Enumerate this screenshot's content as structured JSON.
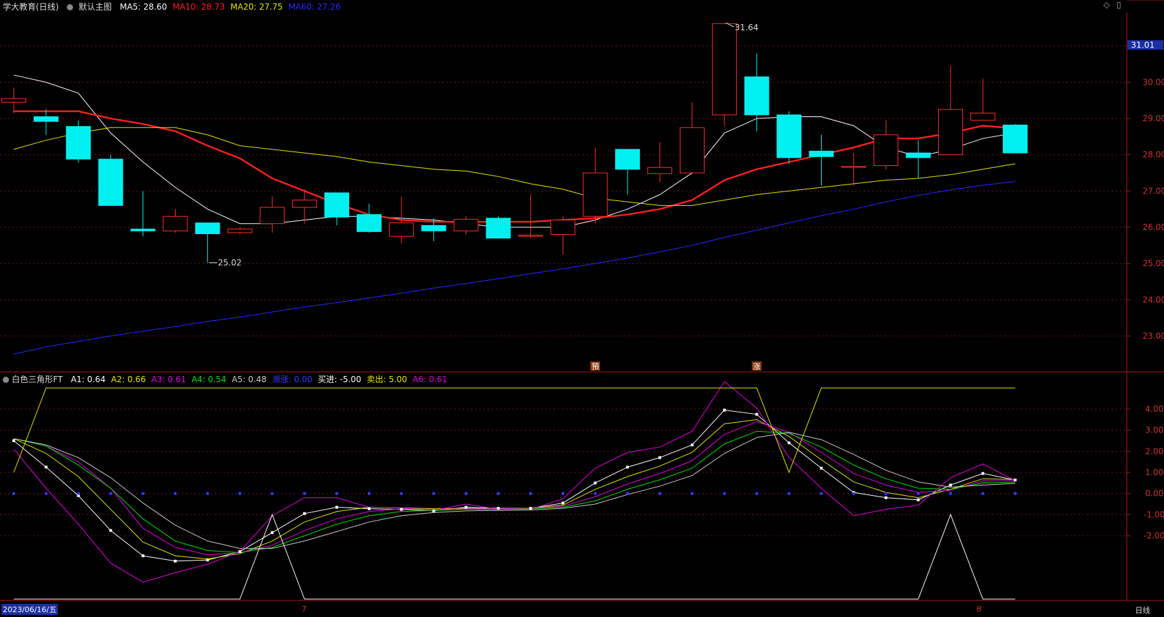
{
  "stock": {
    "title": "学大教育(日线)",
    "template": "默认主图",
    "ma": [
      {
        "label": "MA5: 28.60",
        "color": "#ffffff"
      },
      {
        "label": "MA10: 28.73",
        "color": "#ff2020"
      },
      {
        "label": "MA20: 27.75",
        "color": "#e6e600"
      },
      {
        "label": "MA60: 27.26",
        "color": "#2a2aff"
      }
    ],
    "current_price": "31.01",
    "high_label": "31.64",
    "low_label": "25.02",
    "signals": [
      "預",
      "涨"
    ],
    "window_icons": [
      "◇",
      "▯"
    ]
  },
  "indicator": {
    "name": "白色三角形FT",
    "items": [
      {
        "label": "A1: 0.64",
        "color": "#ffffff"
      },
      {
        "label": "A2: 0.66",
        "color": "#e6e600"
      },
      {
        "label": "A3: 0.61",
        "color": "#e000e0"
      },
      {
        "label": "A4: 0.54",
        "color": "#00e000"
      },
      {
        "label": "A5: 0.48",
        "color": "#cccccc"
      },
      {
        "label": "濒涨: 0.00",
        "color": "#3a3aff"
      },
      {
        "label": "买进: -5.00",
        "color": "#ffffff"
      },
      {
        "label": "卖出: 5.00",
        "color": "#e6e600"
      },
      {
        "label": "A6: 0.61",
        "color": "#e000e0"
      }
    ]
  },
  "bottom": {
    "date_label": "2023/06/16/五",
    "month_7": "7",
    "month_8": "8",
    "period": "日线"
  },
  "chart_data": [
    {
      "type": "candlestick",
      "ylim": [
        22.2,
        31.7
      ],
      "yticks": [
        "31.00",
        "30.00",
        "29.00",
        "28.00",
        "27.00",
        "26.00",
        "25.00",
        "24.00",
        "23.00"
      ],
      "ytick_values": [
        31,
        30,
        29,
        28,
        27,
        26,
        25,
        24,
        23
      ],
      "candles": [
        {
          "o": 29.45,
          "c": 29.55,
          "h": 29.85,
          "l": 29.15
        },
        {
          "o": 29.05,
          "c": 28.92,
          "h": 29.25,
          "l": 28.55
        },
        {
          "o": 28.78,
          "c": 27.88,
          "h": 28.95,
          "l": 27.78
        },
        {
          "o": 27.88,
          "c": 26.6,
          "h": 28.0,
          "l": 26.6
        },
        {
          "o": 25.95,
          "c": 25.9,
          "h": 27.0,
          "l": 25.75
        },
        {
          "o": 25.9,
          "c": 26.3,
          "h": 26.5,
          "l": 25.85
        },
        {
          "o": 26.12,
          "c": 25.82,
          "h": 26.12,
          "l": 25.02
        },
        {
          "o": 25.85,
          "c": 25.95,
          "h": 26.0,
          "l": 25.8
        },
        {
          "o": 26.1,
          "c": 26.55,
          "h": 26.85,
          "l": 25.85
        },
        {
          "o": 26.55,
          "c": 26.75,
          "h": 27.05,
          "l": 26.1
        },
        {
          "o": 26.95,
          "c": 26.28,
          "h": 26.95,
          "l": 26.05
        },
        {
          "o": 26.35,
          "c": 25.88,
          "h": 26.65,
          "l": 25.85
        },
        {
          "o": 25.75,
          "c": 26.12,
          "h": 26.85,
          "l": 25.55
        },
        {
          "o": 26.05,
          "c": 25.9,
          "h": 26.25,
          "l": 25.62
        },
        {
          "o": 25.9,
          "c": 26.22,
          "h": 26.3,
          "l": 25.8
        },
        {
          "o": 26.25,
          "c": 25.7,
          "h": 26.3,
          "l": 25.7
        },
        {
          "o": 25.75,
          "c": 25.78,
          "h": 26.9,
          "l": 25.7
        },
        {
          "o": 25.8,
          "c": 26.2,
          "h": 26.3,
          "l": 25.25
        },
        {
          "o": 26.3,
          "c": 27.5,
          "h": 28.2,
          "l": 26.1
        },
        {
          "o": 28.15,
          "c": 27.6,
          "h": 28.15,
          "l": 26.9
        },
        {
          "o": 27.48,
          "c": 27.65,
          "h": 28.35,
          "l": 27.25
        },
        {
          "o": 27.5,
          "c": 28.75,
          "h": 29.45,
          "l": 27.45
        },
        {
          "o": 29.1,
          "c": 31.62,
          "h": 31.64,
          "l": 28.8
        },
        {
          "o": 30.15,
          "c": 29.1,
          "h": 30.8,
          "l": 28.65
        },
        {
          "o": 29.1,
          "c": 27.92,
          "h": 29.2,
          "l": 27.75
        },
        {
          "o": 28.1,
          "c": 27.95,
          "h": 28.55,
          "l": 27.15
        },
        {
          "o": 27.65,
          "c": 27.68,
          "h": 28.05,
          "l": 27.15
        },
        {
          "o": 27.7,
          "c": 28.55,
          "h": 28.95,
          "l": 27.6
        },
        {
          "o": 28.05,
          "c": 27.92,
          "h": 28.4,
          "l": 27.35
        },
        {
          "o": 28.0,
          "c": 29.25,
          "h": 30.45,
          "l": 28.0
        },
        {
          "o": 28.95,
          "c": 29.15,
          "h": 30.1,
          "l": 28.95
        },
        {
          "o": 28.82,
          "c": 28.05,
          "h": 28.85,
          "l": 28.05
        }
      ],
      "series": [
        {
          "name": "MA5",
          "color": "#ffffff",
          "width": 1,
          "values": [
            30.2,
            30.0,
            29.7,
            28.6,
            27.8,
            27.1,
            26.5,
            26.1,
            26.1,
            26.2,
            26.3,
            26.3,
            26.25,
            26.2,
            26.1,
            26.0,
            26.0,
            26.0,
            26.2,
            26.5,
            26.9,
            27.5,
            28.6,
            29.0,
            29.05,
            29.05,
            28.8,
            28.2,
            27.95,
            28.15,
            28.45,
            28.6
          ]
        },
        {
          "name": "MA10",
          "color": "#ff2020",
          "width": 2.4,
          "values": [
            29.2,
            29.2,
            29.2,
            29.0,
            28.85,
            28.65,
            28.25,
            27.9,
            27.35,
            27.0,
            26.65,
            26.35,
            26.2,
            26.15,
            26.15,
            26.15,
            26.15,
            26.2,
            26.25,
            26.35,
            26.5,
            26.75,
            27.3,
            27.6,
            27.8,
            28.0,
            28.2,
            28.45,
            28.45,
            28.6,
            28.8,
            28.73
          ]
        },
        {
          "name": "MA20",
          "color": "#e6e600",
          "width": 1,
          "values": [
            28.15,
            28.4,
            28.6,
            28.75,
            28.75,
            28.75,
            28.55,
            28.25,
            28.15,
            28.05,
            27.95,
            27.8,
            27.7,
            27.6,
            27.55,
            27.4,
            27.2,
            27.05,
            26.8,
            26.7,
            26.6,
            26.6,
            26.75,
            26.9,
            27.0,
            27.1,
            27.2,
            27.3,
            27.35,
            27.45,
            27.6,
            27.75
          ]
        },
        {
          "name": "MA60",
          "color": "#2a2aff",
          "width": 1,
          "values": [
            22.5,
            22.7,
            22.85,
            23.0,
            23.13,
            23.26,
            23.4,
            23.52,
            23.66,
            23.8,
            23.92,
            24.05,
            24.18,
            24.32,
            24.45,
            24.58,
            24.72,
            24.85,
            25.0,
            25.15,
            25.32,
            25.5,
            25.72,
            25.92,
            26.12,
            26.32,
            26.5,
            26.7,
            26.88,
            27.03,
            27.16,
            27.26
          ]
        }
      ]
    },
    {
      "type": "line",
      "ylim": [
        -5.0,
        5.5
      ],
      "yticks": [
        "4.00",
        "3.00",
        "2.00",
        "1.00",
        "0.00",
        "-1.00",
        "-2.00"
      ],
      "ytick_values": [
        4,
        3,
        2,
        1,
        0,
        -1,
        -2
      ],
      "series": [
        {
          "name": "A1",
          "color": "#ffffff",
          "values": [
            2.5,
            1.25,
            -0.1,
            -1.75,
            -2.95,
            -3.2,
            -3.15,
            -2.75,
            -1.85,
            -0.95,
            -0.65,
            -0.72,
            -0.75,
            -0.82,
            -0.65,
            -0.7,
            -0.7,
            -0.45,
            0.5,
            1.25,
            1.7,
            2.3,
            3.95,
            3.75,
            2.4,
            1.2,
            0.05,
            -0.2,
            -0.3,
            0.4,
            0.95,
            0.64
          ]
        },
        {
          "name": "A2",
          "color": "#e6e600",
          "values": [
            2.6,
            1.9,
            0.8,
            -0.75,
            -2.3,
            -2.95,
            -3.1,
            -2.85,
            -2.25,
            -1.35,
            -0.85,
            -0.65,
            -0.68,
            -0.72,
            -0.7,
            -0.72,
            -0.7,
            -0.55,
            0.2,
            0.8,
            1.3,
            1.95,
            3.3,
            3.5,
            2.7,
            1.6,
            0.55,
            0.05,
            -0.2,
            0.2,
            0.7,
            0.66
          ]
        },
        {
          "name": "A3",
          "color": "#e000e0",
          "values": [
            2.6,
            2.25,
            1.5,
            0.25,
            -1.65,
            -2.55,
            -2.9,
            -2.8,
            -2.45,
            -1.75,
            -1.2,
            -0.85,
            -0.72,
            -0.75,
            -0.72,
            -0.72,
            -0.7,
            -0.6,
            -0.15,
            0.45,
            0.95,
            1.55,
            2.8,
            3.4,
            2.9,
            1.95,
            0.95,
            0.4,
            0.05,
            0.15,
            0.6,
            0.61
          ]
        },
        {
          "name": "A4",
          "color": "#00e000",
          "values": [
            2.6,
            2.25,
            1.35,
            0.25,
            -1.2,
            -2.25,
            -2.7,
            -2.8,
            -2.55,
            -2.0,
            -1.45,
            -1.05,
            -0.85,
            -0.8,
            -0.75,
            -0.75,
            -0.72,
            -0.65,
            -0.35,
            0.2,
            0.65,
            1.2,
            2.35,
            2.95,
            2.85,
            2.2,
            1.35,
            0.7,
            0.25,
            0.2,
            0.5,
            0.54
          ]
        },
        {
          "name": "A5",
          "color": "#cccccc",
          "values": [
            2.6,
            2.3,
            1.7,
            0.75,
            -0.45,
            -1.5,
            -2.25,
            -2.6,
            -2.6,
            -2.25,
            -1.8,
            -1.35,
            -1.05,
            -0.9,
            -0.82,
            -0.8,
            -0.78,
            -0.7,
            -0.5,
            -0.05,
            0.35,
            0.85,
            1.9,
            2.65,
            2.9,
            2.55,
            1.85,
            1.1,
            0.55,
            0.3,
            0.4,
            0.48
          ]
        },
        {
          "name": "A6",
          "color": "#e000e0",
          "values": [
            2.1,
            0.25,
            -1.45,
            -3.3,
            -4.2,
            -3.75,
            -3.35,
            -2.75,
            -1.05,
            -0.2,
            -0.2,
            -0.65,
            -0.68,
            -0.8,
            -0.5,
            -0.75,
            -0.75,
            -0.25,
            1.2,
            1.95,
            2.2,
            2.95,
            5.3,
            4.05,
            1.7,
            0.25,
            -1.05,
            -0.75,
            -0.55,
            0.75,
            1.4,
            0.61
          ]
        },
        {
          "name": "卖出",
          "color": "#e6e600",
          "values": [
            1.0,
            5.0,
            5.0,
            5.0,
            5.0,
            5.0,
            5.0,
            5.0,
            5.0,
            5.0,
            5.0,
            5.0,
            5.0,
            5.0,
            5.0,
            5.0,
            5.0,
            5.0,
            5.0,
            5.0,
            5.0,
            5.0,
            5.0,
            5.0,
            1.0,
            5.0,
            5.0,
            5.0,
            5.0,
            5.0,
            5.0,
            5.0
          ]
        },
        {
          "name": "买进",
          "color": "#ffffff",
          "values": [
            -5.0,
            -5.0,
            -5.0,
            -5.0,
            -5.0,
            -5.0,
            -5.0,
            -5.0,
            -1.0,
            -5.0,
            -5.0,
            -5.0,
            -5.0,
            -5.0,
            -5.0,
            -5.0,
            -5.0,
            -5.0,
            -5.0,
            -5.0,
            -5.0,
            -5.0,
            -5.0,
            -5.0,
            -5.0,
            -5.0,
            -5.0,
            -5.0,
            -5.0,
            -1.0,
            -5.0,
            -5.0
          ]
        }
      ],
      "markers": {
        "name": "濒涨",
        "color": "#3a3aff",
        "value": 0.0
      }
    }
  ]
}
